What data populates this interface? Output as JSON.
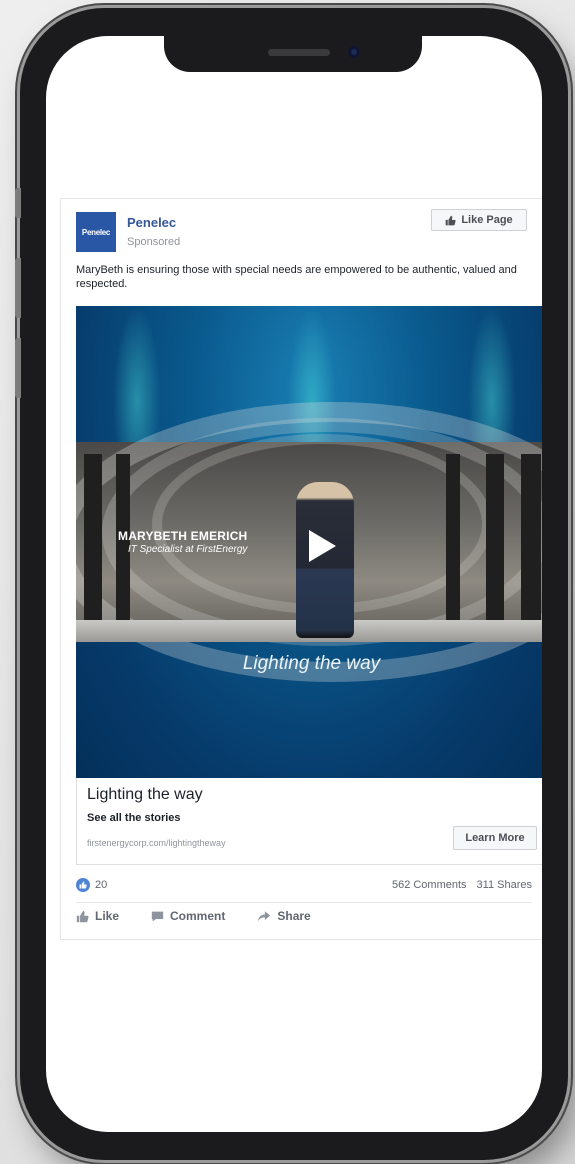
{
  "post": {
    "page_name": "Penelec",
    "logo_text": "Penelec",
    "sponsored": "Sponsored",
    "like_page_label": "Like Page",
    "caption": "MaryBeth is ensuring those with special needs are empowered to be authentic, valued and respected."
  },
  "video": {
    "person_name": "MARYBETH EMERICH",
    "person_title": "IT Specialist at FirstEnergy",
    "overlay_title": "Lighting the way"
  },
  "link": {
    "title": "Lighting the way",
    "subtitle": "See all the stories",
    "url": "firstenergycorp.com/lightingtheway",
    "cta_label": "Learn More"
  },
  "engagement": {
    "likes": "20",
    "comments": "562 Comments",
    "shares": "311 Shares"
  },
  "actions": {
    "like": "Like",
    "comment": "Comment",
    "share": "Share"
  },
  "colors": {
    "brand_blue": "#2a56a6",
    "link_blue": "#365899",
    "reaction_blue": "#4e83d6"
  }
}
